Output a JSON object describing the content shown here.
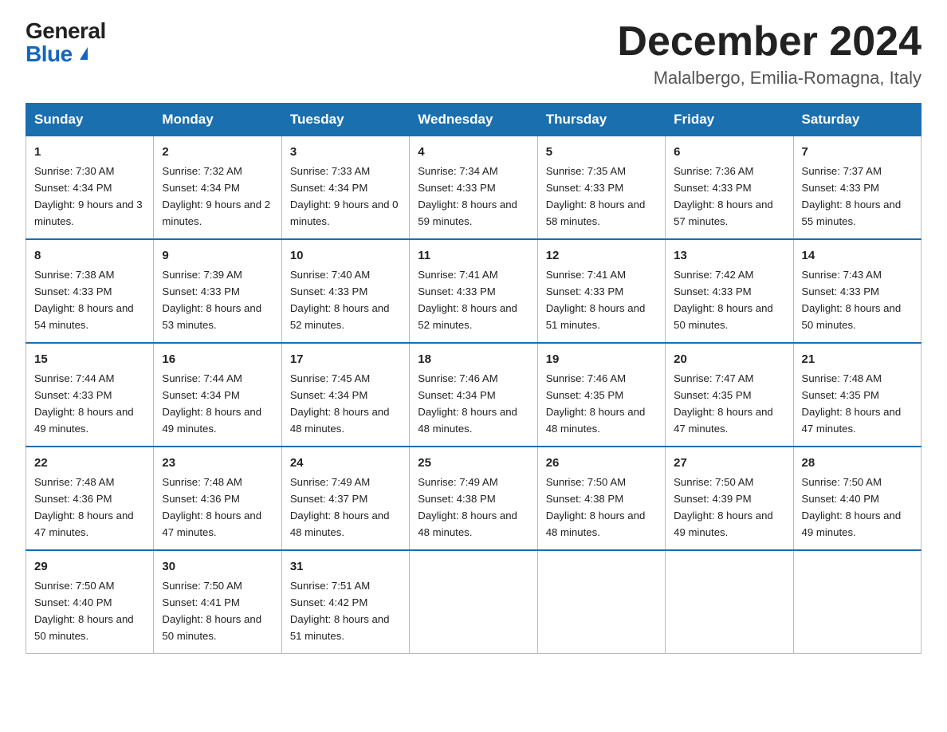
{
  "header": {
    "logo_general": "General",
    "logo_blue": "Blue",
    "title": "December 2024",
    "location": "Malalbergo, Emilia-Romagna, Italy"
  },
  "days_of_week": [
    "Sunday",
    "Monday",
    "Tuesday",
    "Wednesday",
    "Thursday",
    "Friday",
    "Saturday"
  ],
  "weeks": [
    [
      {
        "day": "1",
        "sunrise": "7:30 AM",
        "sunset": "4:34 PM",
        "daylight": "9 hours and 3 minutes."
      },
      {
        "day": "2",
        "sunrise": "7:32 AM",
        "sunset": "4:34 PM",
        "daylight": "9 hours and 2 minutes."
      },
      {
        "day": "3",
        "sunrise": "7:33 AM",
        "sunset": "4:34 PM",
        "daylight": "9 hours and 0 minutes."
      },
      {
        "day": "4",
        "sunrise": "7:34 AM",
        "sunset": "4:33 PM",
        "daylight": "8 hours and 59 minutes."
      },
      {
        "day": "5",
        "sunrise": "7:35 AM",
        "sunset": "4:33 PM",
        "daylight": "8 hours and 58 minutes."
      },
      {
        "day": "6",
        "sunrise": "7:36 AM",
        "sunset": "4:33 PM",
        "daylight": "8 hours and 57 minutes."
      },
      {
        "day": "7",
        "sunrise": "7:37 AM",
        "sunset": "4:33 PM",
        "daylight": "8 hours and 55 minutes."
      }
    ],
    [
      {
        "day": "8",
        "sunrise": "7:38 AM",
        "sunset": "4:33 PM",
        "daylight": "8 hours and 54 minutes."
      },
      {
        "day": "9",
        "sunrise": "7:39 AM",
        "sunset": "4:33 PM",
        "daylight": "8 hours and 53 minutes."
      },
      {
        "day": "10",
        "sunrise": "7:40 AM",
        "sunset": "4:33 PM",
        "daylight": "8 hours and 52 minutes."
      },
      {
        "day": "11",
        "sunrise": "7:41 AM",
        "sunset": "4:33 PM",
        "daylight": "8 hours and 52 minutes."
      },
      {
        "day": "12",
        "sunrise": "7:41 AM",
        "sunset": "4:33 PM",
        "daylight": "8 hours and 51 minutes."
      },
      {
        "day": "13",
        "sunrise": "7:42 AM",
        "sunset": "4:33 PM",
        "daylight": "8 hours and 50 minutes."
      },
      {
        "day": "14",
        "sunrise": "7:43 AM",
        "sunset": "4:33 PM",
        "daylight": "8 hours and 50 minutes."
      }
    ],
    [
      {
        "day": "15",
        "sunrise": "7:44 AM",
        "sunset": "4:33 PM",
        "daylight": "8 hours and 49 minutes."
      },
      {
        "day": "16",
        "sunrise": "7:44 AM",
        "sunset": "4:34 PM",
        "daylight": "8 hours and 49 minutes."
      },
      {
        "day": "17",
        "sunrise": "7:45 AM",
        "sunset": "4:34 PM",
        "daylight": "8 hours and 48 minutes."
      },
      {
        "day": "18",
        "sunrise": "7:46 AM",
        "sunset": "4:34 PM",
        "daylight": "8 hours and 48 minutes."
      },
      {
        "day": "19",
        "sunrise": "7:46 AM",
        "sunset": "4:35 PM",
        "daylight": "8 hours and 48 minutes."
      },
      {
        "day": "20",
        "sunrise": "7:47 AM",
        "sunset": "4:35 PM",
        "daylight": "8 hours and 47 minutes."
      },
      {
        "day": "21",
        "sunrise": "7:48 AM",
        "sunset": "4:35 PM",
        "daylight": "8 hours and 47 minutes."
      }
    ],
    [
      {
        "day": "22",
        "sunrise": "7:48 AM",
        "sunset": "4:36 PM",
        "daylight": "8 hours and 47 minutes."
      },
      {
        "day": "23",
        "sunrise": "7:48 AM",
        "sunset": "4:36 PM",
        "daylight": "8 hours and 47 minutes."
      },
      {
        "day": "24",
        "sunrise": "7:49 AM",
        "sunset": "4:37 PM",
        "daylight": "8 hours and 48 minutes."
      },
      {
        "day": "25",
        "sunrise": "7:49 AM",
        "sunset": "4:38 PM",
        "daylight": "8 hours and 48 minutes."
      },
      {
        "day": "26",
        "sunrise": "7:50 AM",
        "sunset": "4:38 PM",
        "daylight": "8 hours and 48 minutes."
      },
      {
        "day": "27",
        "sunrise": "7:50 AM",
        "sunset": "4:39 PM",
        "daylight": "8 hours and 49 minutes."
      },
      {
        "day": "28",
        "sunrise": "7:50 AM",
        "sunset": "4:40 PM",
        "daylight": "8 hours and 49 minutes."
      }
    ],
    [
      {
        "day": "29",
        "sunrise": "7:50 AM",
        "sunset": "4:40 PM",
        "daylight": "8 hours and 50 minutes."
      },
      {
        "day": "30",
        "sunrise": "7:50 AM",
        "sunset": "4:41 PM",
        "daylight": "8 hours and 50 minutes."
      },
      {
        "day": "31",
        "sunrise": "7:51 AM",
        "sunset": "4:42 PM",
        "daylight": "8 hours and 51 minutes."
      },
      null,
      null,
      null,
      null
    ]
  ],
  "labels": {
    "sunrise": "Sunrise:",
    "sunset": "Sunset:",
    "daylight": "Daylight:"
  }
}
